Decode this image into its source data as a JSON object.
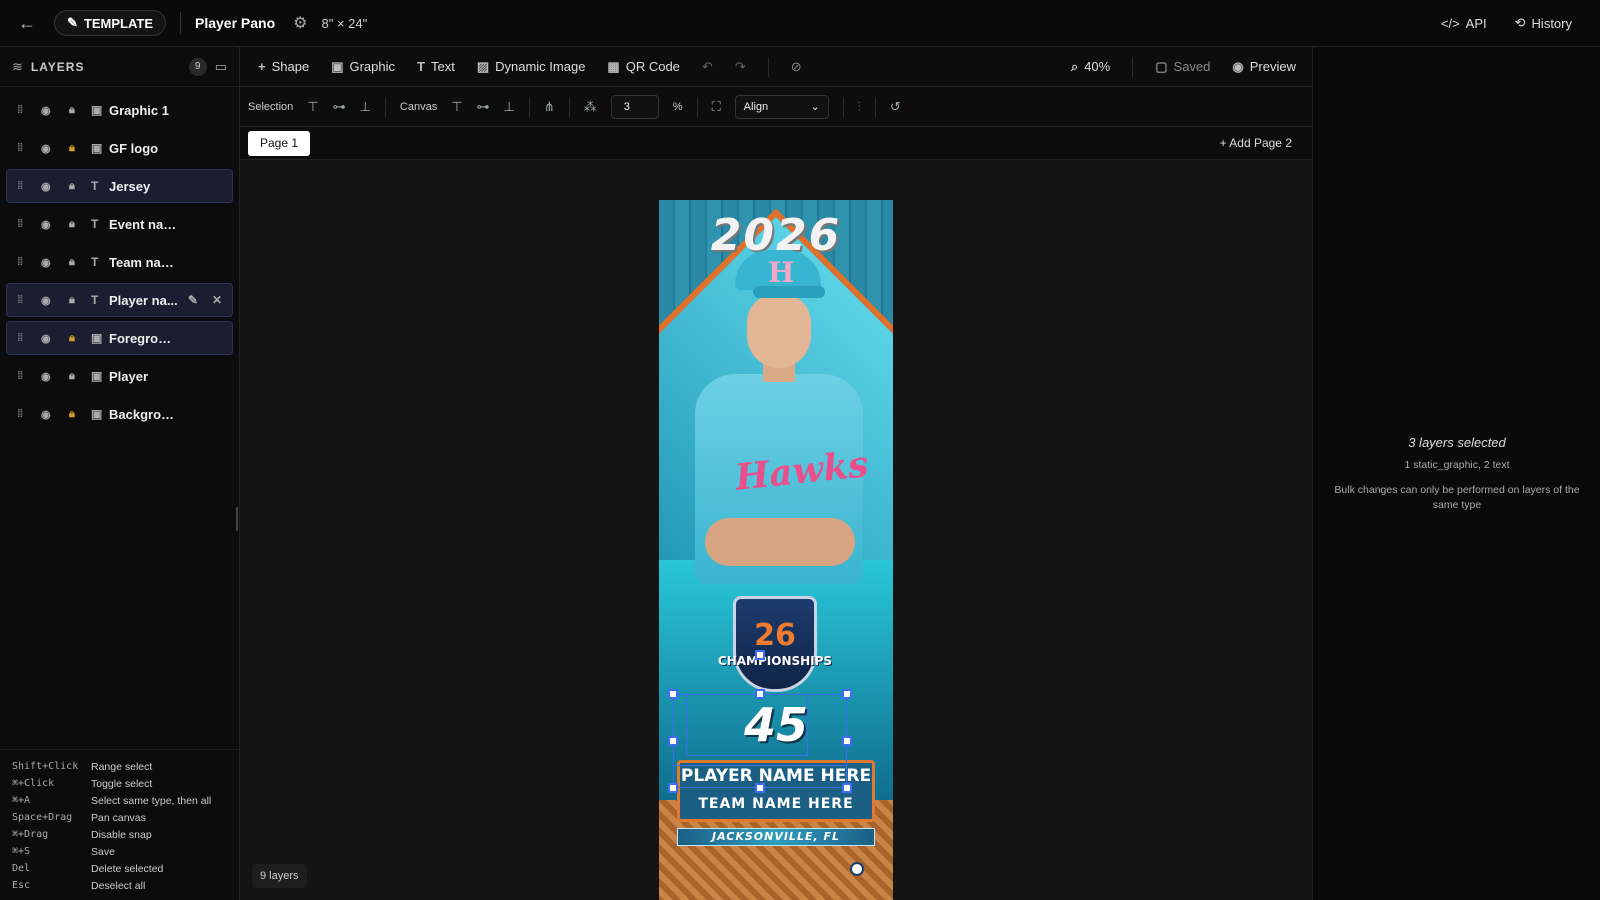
{
  "topbar": {
    "badge_label": "TEMPLATE",
    "template_name": "Player Pano",
    "size": "8\" × 24\"",
    "api_label": "API",
    "history_label": "History"
  },
  "layers_panel": {
    "title": "LAYERS",
    "count": "9",
    "items": [
      {
        "name": "Graphic 1",
        "type": "image",
        "locked": false,
        "selected": false
      },
      {
        "name": "GF logo",
        "type": "image",
        "locked": true,
        "selected": false
      },
      {
        "name": "Jersey",
        "type": "text",
        "locked": false,
        "selected": true
      },
      {
        "name": "Event name",
        "type": "text",
        "locked": false,
        "selected": false
      },
      {
        "name": "Team name",
        "type": "text",
        "locked": false,
        "selected": false
      },
      {
        "name": "Player na...",
        "type": "text",
        "locked": false,
        "selected": true
      },
      {
        "name": "Foreground",
        "type": "image",
        "locked": true,
        "selected": true
      },
      {
        "name": "Player",
        "type": "image",
        "locked": false,
        "selected": false
      },
      {
        "name": "Backgrou...",
        "type": "image",
        "locked": true,
        "selected": false
      }
    ],
    "shortcuts": [
      {
        "key": "Shift+Click",
        "desc": "Range select"
      },
      {
        "key": "⌘+Click",
        "desc": "Toggle select"
      },
      {
        "key": "⌘+A",
        "desc": "Select same type, then all"
      },
      {
        "key": "Space+Drag",
        "desc": "Pan canvas"
      },
      {
        "key": "⌘+Drag",
        "desc": "Disable snap"
      },
      {
        "key": "⌘+S",
        "desc": "Save"
      },
      {
        "key": "Del",
        "desc": "Delete selected"
      },
      {
        "key": "Esc",
        "desc": "Deselect all"
      }
    ]
  },
  "toolbar": {
    "shape": "Shape",
    "graphic": "Graphic",
    "text": "Text",
    "dynamic_image": "Dynamic Image",
    "qr_code": "QR Code",
    "zoom": "40%",
    "saved": "Saved",
    "preview": "Preview"
  },
  "align_bar": {
    "selection_label": "Selection",
    "canvas_label": "Canvas",
    "spacing_value": "3",
    "spacing_unit": "%",
    "align_select": "Align"
  },
  "pages": {
    "current": "Page 1",
    "add_label": "+ Add Page 2"
  },
  "artwork": {
    "year": "2026",
    "cap_letter": "H",
    "jersey_script": "Hawks",
    "event_number": "26",
    "event_title": "CHAMPIONSHIPS",
    "jersey_number": "45",
    "player_name": "PLAYER NAME HERE",
    "team_name": "TEAM NAME HERE",
    "city": "JACKSONVILLE, FL"
  },
  "layer_count_badge": "9 layers",
  "inspector": {
    "title": "3 layers selected",
    "subtitle": "1 static_graphic, 2 text",
    "note": "Bulk changes can only be performed on layers of the same type"
  },
  "colors": {
    "accent": "#3b6ef0",
    "selected_row": "#1b1d30",
    "lock_gold": "#d89a2a"
  }
}
